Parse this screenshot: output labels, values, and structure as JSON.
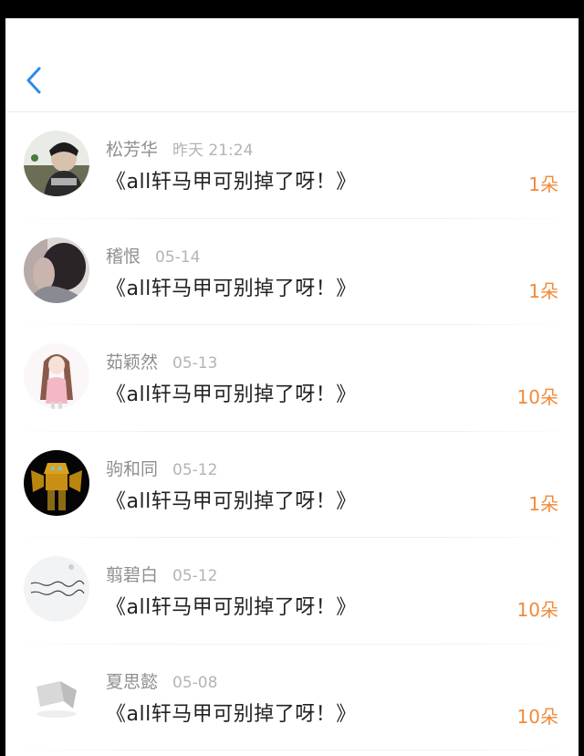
{
  "colors": {
    "accent_blue": "#2e8ae6",
    "gift_orange": "#f08a3a",
    "name_gray": "#8f8f8f",
    "date_gray": "#b4b4b4",
    "message_text": "#222222"
  },
  "header": {
    "back_icon": "chevron-left-icon"
  },
  "list": [
    {
      "name": "松芳华",
      "date": "昨天 21:24",
      "message": "《all轩马甲可别掉了呀！》",
      "gift": "1朵",
      "avatar": "boy-photo"
    },
    {
      "name": "稽恨",
      "date": "05-14",
      "message": "《all轩马甲可别掉了呀！》",
      "gift": "1朵",
      "avatar": "person-photo"
    },
    {
      "name": "茹颖然",
      "date": "05-13",
      "message": "《all轩马甲可别掉了呀！》",
      "gift": "10朵",
      "avatar": "anime-girl"
    },
    {
      "name": "驹和同",
      "date": "05-12",
      "message": "《all轩马甲可别掉了呀！》",
      "gift": "1朵",
      "avatar": "robot"
    },
    {
      "name": "翦碧白",
      "date": "05-12",
      "message": "《all轩马甲可别掉了呀！》",
      "gift": "10朵",
      "avatar": "handwriting"
    },
    {
      "name": "夏思懿",
      "date": "05-08",
      "message": "《all轩马甲可别掉了呀！》",
      "gift": "10朵",
      "avatar": "light-sketch"
    }
  ]
}
